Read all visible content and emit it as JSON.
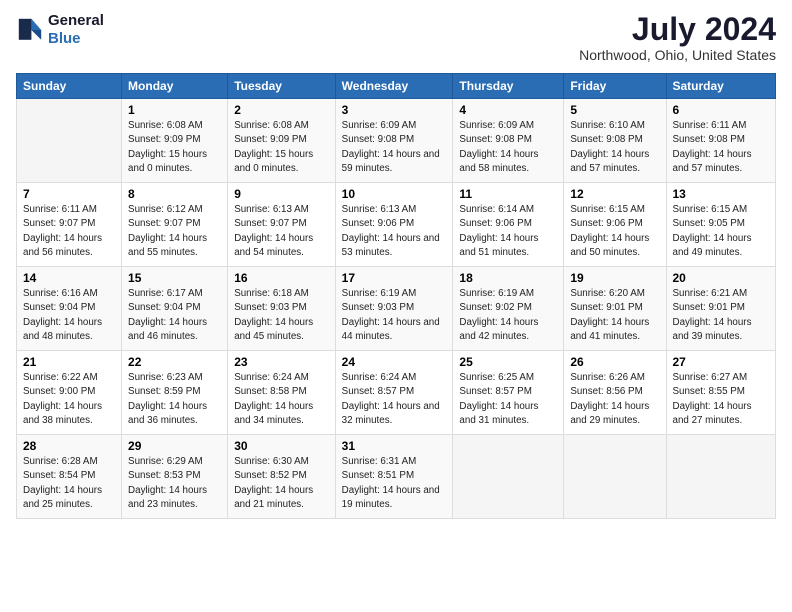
{
  "logo": {
    "line1": "General",
    "line2": "Blue"
  },
  "title": "July 2024",
  "subtitle": "Northwood, Ohio, United States",
  "days_header": [
    "Sunday",
    "Monday",
    "Tuesday",
    "Wednesday",
    "Thursday",
    "Friday",
    "Saturday"
  ],
  "weeks": [
    [
      {
        "day": "",
        "sunrise": "",
        "sunset": "",
        "daylight": ""
      },
      {
        "day": "1",
        "sunrise": "Sunrise: 6:08 AM",
        "sunset": "Sunset: 9:09 PM",
        "daylight": "Daylight: 15 hours and 0 minutes."
      },
      {
        "day": "2",
        "sunrise": "Sunrise: 6:08 AM",
        "sunset": "Sunset: 9:09 PM",
        "daylight": "Daylight: 15 hours and 0 minutes."
      },
      {
        "day": "3",
        "sunrise": "Sunrise: 6:09 AM",
        "sunset": "Sunset: 9:08 PM",
        "daylight": "Daylight: 14 hours and 59 minutes."
      },
      {
        "day": "4",
        "sunrise": "Sunrise: 6:09 AM",
        "sunset": "Sunset: 9:08 PM",
        "daylight": "Daylight: 14 hours and 58 minutes."
      },
      {
        "day": "5",
        "sunrise": "Sunrise: 6:10 AM",
        "sunset": "Sunset: 9:08 PM",
        "daylight": "Daylight: 14 hours and 57 minutes."
      },
      {
        "day": "6",
        "sunrise": "Sunrise: 6:11 AM",
        "sunset": "Sunset: 9:08 PM",
        "daylight": "Daylight: 14 hours and 57 minutes."
      }
    ],
    [
      {
        "day": "7",
        "sunrise": "Sunrise: 6:11 AM",
        "sunset": "Sunset: 9:07 PM",
        "daylight": "Daylight: 14 hours and 56 minutes."
      },
      {
        "day": "8",
        "sunrise": "Sunrise: 6:12 AM",
        "sunset": "Sunset: 9:07 PM",
        "daylight": "Daylight: 14 hours and 55 minutes."
      },
      {
        "day": "9",
        "sunrise": "Sunrise: 6:13 AM",
        "sunset": "Sunset: 9:07 PM",
        "daylight": "Daylight: 14 hours and 54 minutes."
      },
      {
        "day": "10",
        "sunrise": "Sunrise: 6:13 AM",
        "sunset": "Sunset: 9:06 PM",
        "daylight": "Daylight: 14 hours and 53 minutes."
      },
      {
        "day": "11",
        "sunrise": "Sunrise: 6:14 AM",
        "sunset": "Sunset: 9:06 PM",
        "daylight": "Daylight: 14 hours and 51 minutes."
      },
      {
        "day": "12",
        "sunrise": "Sunrise: 6:15 AM",
        "sunset": "Sunset: 9:06 PM",
        "daylight": "Daylight: 14 hours and 50 minutes."
      },
      {
        "day": "13",
        "sunrise": "Sunrise: 6:15 AM",
        "sunset": "Sunset: 9:05 PM",
        "daylight": "Daylight: 14 hours and 49 minutes."
      }
    ],
    [
      {
        "day": "14",
        "sunrise": "Sunrise: 6:16 AM",
        "sunset": "Sunset: 9:04 PM",
        "daylight": "Daylight: 14 hours and 48 minutes."
      },
      {
        "day": "15",
        "sunrise": "Sunrise: 6:17 AM",
        "sunset": "Sunset: 9:04 PM",
        "daylight": "Daylight: 14 hours and 46 minutes."
      },
      {
        "day": "16",
        "sunrise": "Sunrise: 6:18 AM",
        "sunset": "Sunset: 9:03 PM",
        "daylight": "Daylight: 14 hours and 45 minutes."
      },
      {
        "day": "17",
        "sunrise": "Sunrise: 6:19 AM",
        "sunset": "Sunset: 9:03 PM",
        "daylight": "Daylight: 14 hours and 44 minutes."
      },
      {
        "day": "18",
        "sunrise": "Sunrise: 6:19 AM",
        "sunset": "Sunset: 9:02 PM",
        "daylight": "Daylight: 14 hours and 42 minutes."
      },
      {
        "day": "19",
        "sunrise": "Sunrise: 6:20 AM",
        "sunset": "Sunset: 9:01 PM",
        "daylight": "Daylight: 14 hours and 41 minutes."
      },
      {
        "day": "20",
        "sunrise": "Sunrise: 6:21 AM",
        "sunset": "Sunset: 9:01 PM",
        "daylight": "Daylight: 14 hours and 39 minutes."
      }
    ],
    [
      {
        "day": "21",
        "sunrise": "Sunrise: 6:22 AM",
        "sunset": "Sunset: 9:00 PM",
        "daylight": "Daylight: 14 hours and 38 minutes."
      },
      {
        "day": "22",
        "sunrise": "Sunrise: 6:23 AM",
        "sunset": "Sunset: 8:59 PM",
        "daylight": "Daylight: 14 hours and 36 minutes."
      },
      {
        "day": "23",
        "sunrise": "Sunrise: 6:24 AM",
        "sunset": "Sunset: 8:58 PM",
        "daylight": "Daylight: 14 hours and 34 minutes."
      },
      {
        "day": "24",
        "sunrise": "Sunrise: 6:24 AM",
        "sunset": "Sunset: 8:57 PM",
        "daylight": "Daylight: 14 hours and 32 minutes."
      },
      {
        "day": "25",
        "sunrise": "Sunrise: 6:25 AM",
        "sunset": "Sunset: 8:57 PM",
        "daylight": "Daylight: 14 hours and 31 minutes."
      },
      {
        "day": "26",
        "sunrise": "Sunrise: 6:26 AM",
        "sunset": "Sunset: 8:56 PM",
        "daylight": "Daylight: 14 hours and 29 minutes."
      },
      {
        "day": "27",
        "sunrise": "Sunrise: 6:27 AM",
        "sunset": "Sunset: 8:55 PM",
        "daylight": "Daylight: 14 hours and 27 minutes."
      }
    ],
    [
      {
        "day": "28",
        "sunrise": "Sunrise: 6:28 AM",
        "sunset": "Sunset: 8:54 PM",
        "daylight": "Daylight: 14 hours and 25 minutes."
      },
      {
        "day": "29",
        "sunrise": "Sunrise: 6:29 AM",
        "sunset": "Sunset: 8:53 PM",
        "daylight": "Daylight: 14 hours and 23 minutes."
      },
      {
        "day": "30",
        "sunrise": "Sunrise: 6:30 AM",
        "sunset": "Sunset: 8:52 PM",
        "daylight": "Daylight: 14 hours and 21 minutes."
      },
      {
        "day": "31",
        "sunrise": "Sunrise: 6:31 AM",
        "sunset": "Sunset: 8:51 PM",
        "daylight": "Daylight: 14 hours and 19 minutes."
      },
      {
        "day": "",
        "sunrise": "",
        "sunset": "",
        "daylight": ""
      },
      {
        "day": "",
        "sunrise": "",
        "sunset": "",
        "daylight": ""
      },
      {
        "day": "",
        "sunrise": "",
        "sunset": "",
        "daylight": ""
      }
    ]
  ]
}
